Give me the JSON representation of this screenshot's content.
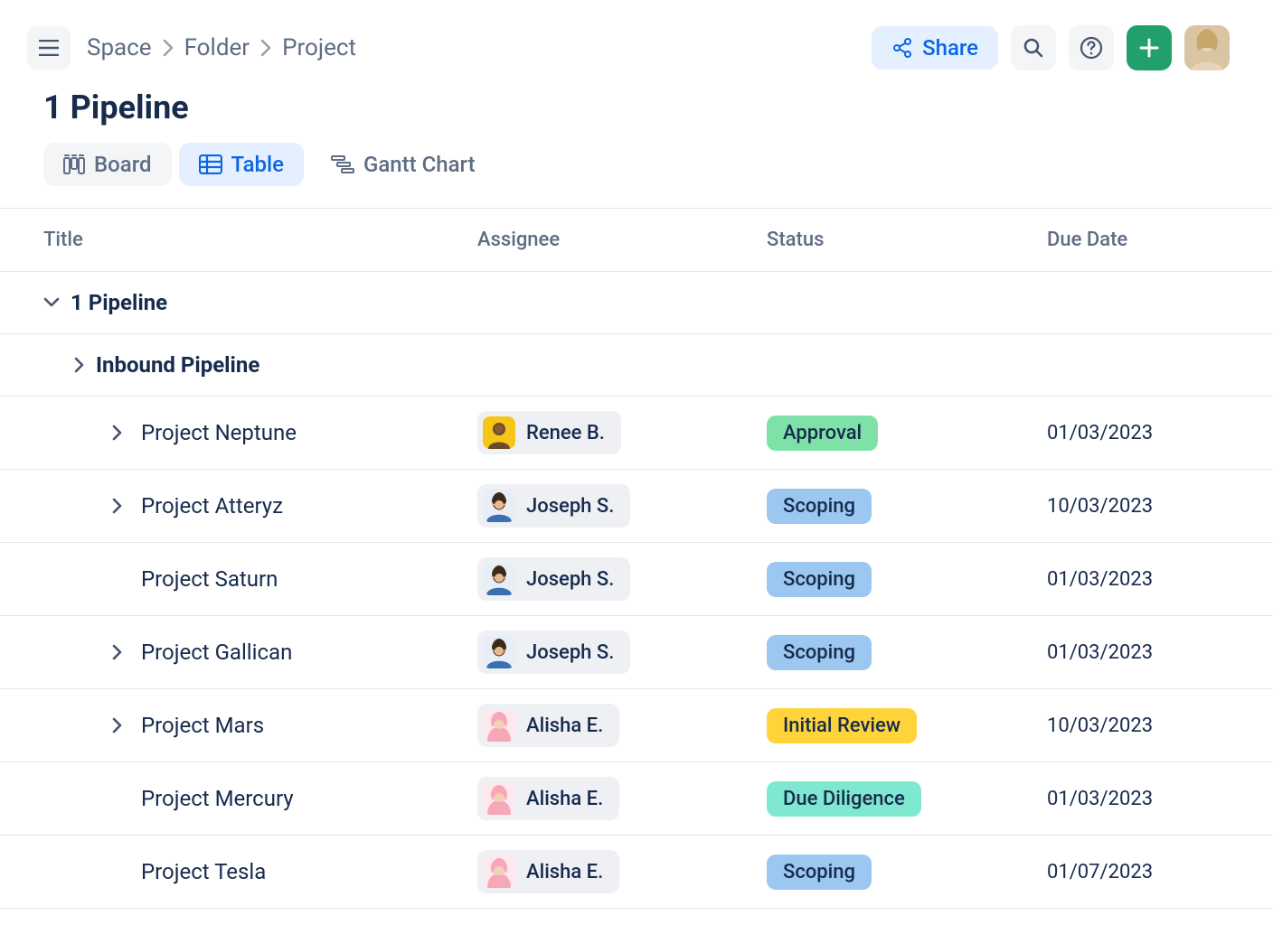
{
  "breadcrumbs": [
    "Space",
    "Folder",
    "Project"
  ],
  "share_label": "Share",
  "page_title": "1 Pipeline",
  "tabs": [
    {
      "label": "Board"
    },
    {
      "label": "Table"
    },
    {
      "label": "Gantt Chart"
    }
  ],
  "active_tab_index": 1,
  "columns": [
    "Title",
    "Assignee",
    "Status",
    "Due Date"
  ],
  "group": {
    "title": "1 Pipeline",
    "subgroup": {
      "title": "Inbound Pipeline"
    }
  },
  "assignee_colors": {
    "Renee B.": "#f5c518",
    "Joseph S.": "#7aa7d9",
    "Alisha E.": "#f5b5c0"
  },
  "status_colors": {
    "Approval": "#7ee2a8",
    "Scoping": "#9cc7f0",
    "Initial Review": "#ffd43b",
    "Due Diligence": "#7ee8d0"
  },
  "rows": [
    {
      "title": "Project Neptune",
      "expandable": true,
      "assignee": "Renee B.",
      "status": "Approval",
      "due": "01/03/2023"
    },
    {
      "title": "Project Atteryz",
      "expandable": true,
      "assignee": "Joseph S.",
      "status": "Scoping",
      "due": "10/03/2023"
    },
    {
      "title": "Project Saturn",
      "expandable": false,
      "assignee": "Joseph S.",
      "status": "Scoping",
      "due": "01/03/2023"
    },
    {
      "title": "Project Gallican",
      "expandable": true,
      "assignee": "Joseph S.",
      "status": "Scoping",
      "due": "01/03/2023"
    },
    {
      "title": "Project Mars",
      "expandable": true,
      "assignee": "Alisha E.",
      "status": "Initial Review",
      "due": "10/03/2023"
    },
    {
      "title": "Project Mercury",
      "expandable": false,
      "assignee": "Alisha E.",
      "status": "Due Diligence",
      "due": "01/03/2023"
    },
    {
      "title": "Project Tesla",
      "expandable": false,
      "assignee": "Alisha E.",
      "status": "Scoping",
      "due": "01/07/2023"
    }
  ]
}
